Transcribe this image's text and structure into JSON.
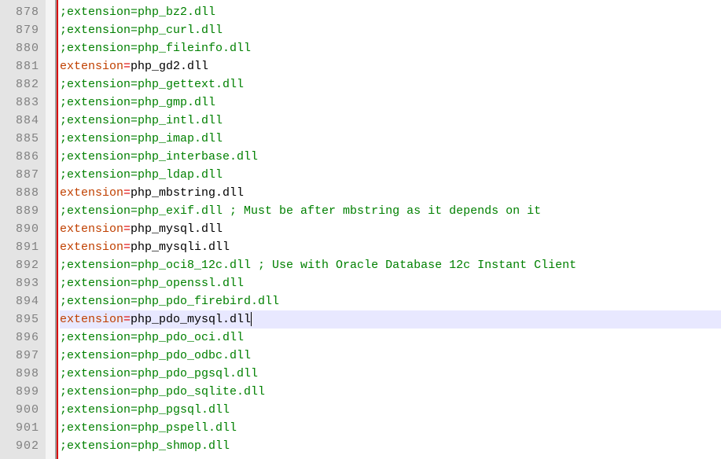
{
  "firstLine": 878,
  "currentLine": 895,
  "lines": [
    {
      "n": 878,
      "type": "comment",
      "raw": ";extension=php_bz2.dll"
    },
    {
      "n": 879,
      "type": "comment",
      "raw": ";extension=php_curl.dll"
    },
    {
      "n": 880,
      "type": "comment",
      "raw": ";extension=php_fileinfo.dll"
    },
    {
      "n": 881,
      "type": "active",
      "key": "extension",
      "val": "php_gd2.dll"
    },
    {
      "n": 882,
      "type": "comment",
      "raw": ";extension=php_gettext.dll"
    },
    {
      "n": 883,
      "type": "comment",
      "raw": ";extension=php_gmp.dll"
    },
    {
      "n": 884,
      "type": "comment",
      "raw": ";extension=php_intl.dll"
    },
    {
      "n": 885,
      "type": "comment",
      "raw": ";extension=php_imap.dll"
    },
    {
      "n": 886,
      "type": "comment",
      "raw": ";extension=php_interbase.dll"
    },
    {
      "n": 887,
      "type": "comment",
      "raw": ";extension=php_ldap.dll"
    },
    {
      "n": 888,
      "type": "active",
      "key": "extension",
      "val": "php_mbstring.dll"
    },
    {
      "n": 889,
      "type": "comment",
      "raw": ";extension=php_exif.dll      ; Must be after mbstring as it depends on it"
    },
    {
      "n": 890,
      "type": "active",
      "key": "extension",
      "val": "php_mysql.dll"
    },
    {
      "n": 891,
      "type": "active",
      "key": "extension",
      "val": "php_mysqli.dll"
    },
    {
      "n": 892,
      "type": "comment",
      "raw": ";extension=php_oci8_12c.dll  ; Use with Oracle Database 12c Instant Client"
    },
    {
      "n": 893,
      "type": "comment",
      "raw": ";extension=php_openssl.dll"
    },
    {
      "n": 894,
      "type": "comment",
      "raw": ";extension=php_pdo_firebird.dll"
    },
    {
      "n": 895,
      "type": "active",
      "key": "extension",
      "val": "php_pdo_mysql.dll"
    },
    {
      "n": 896,
      "type": "comment",
      "raw": ";extension=php_pdo_oci.dll"
    },
    {
      "n": 897,
      "type": "comment",
      "raw": ";extension=php_pdo_odbc.dll"
    },
    {
      "n": 898,
      "type": "comment",
      "raw": ";extension=php_pdo_pgsql.dll"
    },
    {
      "n": 899,
      "type": "comment",
      "raw": ";extension=php_pdo_sqlite.dll"
    },
    {
      "n": 900,
      "type": "comment",
      "raw": ";extension=php_pgsql.dll"
    },
    {
      "n": 901,
      "type": "comment",
      "raw": ";extension=php_pspell.dll"
    },
    {
      "n": 902,
      "type": "comment",
      "raw": ";extension=php_shmop.dll"
    }
  ]
}
